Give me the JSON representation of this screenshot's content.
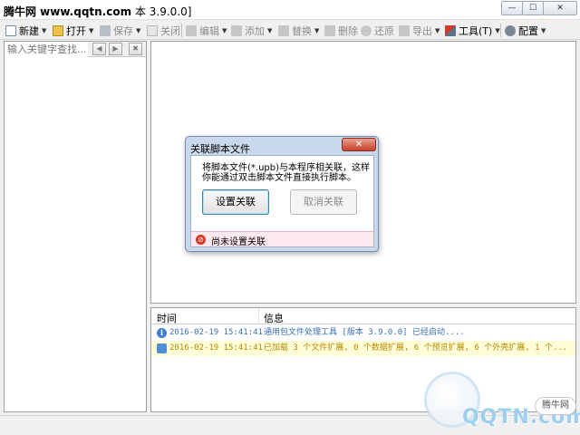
{
  "window": {
    "title_brand": "腾牛网 www.qqtn.com",
    "title_version": "本 3.9.0.0]",
    "minimize_glyph": "—",
    "maximize_glyph": "☐",
    "close_glyph": "✕"
  },
  "toolbar": {
    "new_label": "新建",
    "open_label": "打开",
    "save_label": "保存",
    "close_label": "关闭",
    "edit_label": "编辑",
    "add_label": "添加",
    "replace_label": "替换",
    "delete_label": "删除",
    "restore_label": "还原",
    "export_label": "导出",
    "tools_label": "工具(T)",
    "config_label": "配置",
    "dropdown_glyph": "▼"
  },
  "sidebar": {
    "search_placeholder": "输入关键字查找...",
    "prev_glyph": "◀",
    "next_glyph": "▶",
    "clear_glyph": "✖"
  },
  "dialog": {
    "title": "关联脚本文件",
    "close_glyph": "✕",
    "message": "将脚本文件(*.upb)与本程序相关联，这样\n你能通过双击脚本文件直接执行脚本。",
    "set_button": "设置关联",
    "cancel_button": "取消关联",
    "status": "尚未设置关联",
    "status_color": "#d7381f"
  },
  "log": {
    "col_time": "时间",
    "col_info": "信息",
    "rows": [
      {
        "icon": "info-icon",
        "time": "2016-02-19 15:41:41",
        "message": "通用包文件处理工具 [版本 3.9.0.0] 已经启动....",
        "color": "#3a6fb4"
      },
      {
        "icon": "chat-icon",
        "time": "2016-02-19 15:41:41",
        "message": "已加载 3 个文件扩展, 0 个数据扩展, 6 个预览扩展, 6 个外壳扩展, 1 个...",
        "color": "#b58b00"
      }
    ]
  },
  "watermark": {
    "text": "QQTN.com",
    "badge": "腾牛网"
  }
}
